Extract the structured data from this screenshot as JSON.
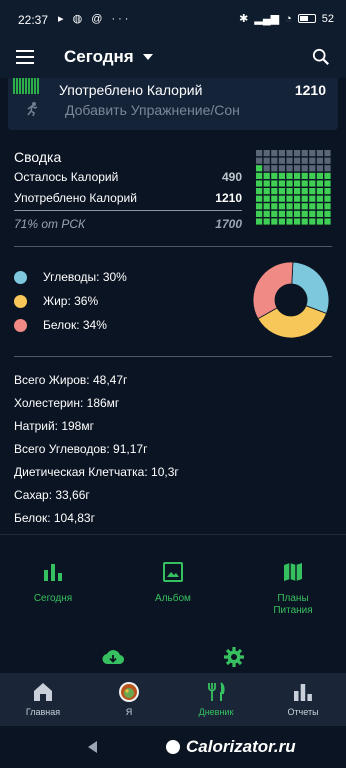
{
  "status_bar": {
    "time": "22:37",
    "battery": "52"
  },
  "app_bar": {
    "title": "Сегодня"
  },
  "top_card": {
    "consumed_label": "Употреблено Калорий",
    "consumed_value": "1210",
    "add_exercise": "Добавить Упражнение/Сон"
  },
  "summary": {
    "title": "Сводка",
    "remaining_label": "Осталось Калорий",
    "remaining_value": "490",
    "consumed_label": "Употреблено Калорий",
    "consumed_value": "1210",
    "rdi_label": "71% от РСК",
    "rdi_value": "1700",
    "grid_filled_fraction": 0.71
  },
  "macros": {
    "items": [
      {
        "label": "Углеводы: 30%",
        "color": "#7ec8de",
        "percent": 30
      },
      {
        "label": "Жир: 36%",
        "color": "#f7c75a",
        "percent": 36
      },
      {
        "label": "Белок: 34%",
        "color": "#f08a84",
        "percent": 34
      }
    ]
  },
  "nutrients": [
    "Всего Жиров: 48,47г",
    "Холестерин: 186мг",
    "Натрий: 198мг",
    "Всего Углеводов: 91,17г",
    "Диетическая Клетчатка: 10,3г",
    "Сахар: 33,66г",
    "Белок: 104,83г"
  ],
  "shortcuts": {
    "today": "Сегодня",
    "album": "Альбом",
    "plans": "Планы Питания"
  },
  "nav": {
    "home": "Главная",
    "me": "Я",
    "diary": "Дневник",
    "reports": "Отчеты"
  },
  "watermark": "Calorizator.ru",
  "colors": {
    "accent": "#37c060",
    "background": "#0b1422",
    "bar": "#0f1c2e"
  }
}
